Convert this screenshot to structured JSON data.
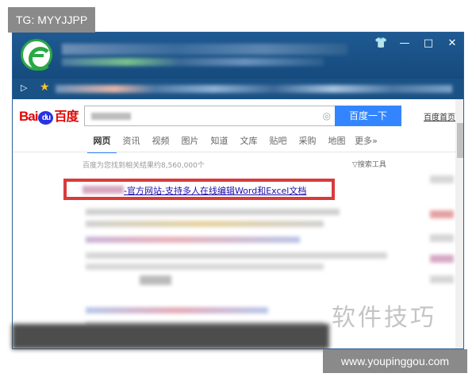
{
  "watermark_tag": "TG: MYYJJPP",
  "window": {
    "titlebar_icons": [
      "shirt-icon",
      "minimize-icon",
      "maximize-icon",
      "close-icon"
    ],
    "titlebar_glyphs": [
      "👕",
      "—",
      "□",
      "✕"
    ]
  },
  "favorites": {
    "play_glyph": "▷",
    "star_glyph": "★"
  },
  "baidu": {
    "logo_bai": "Bai",
    "logo_du": "du",
    "logo_cn": "百度",
    "search_button": "百度一下",
    "camera_glyph": "◎",
    "home_link": "百度首页",
    "tabs": [
      "网页",
      "资讯",
      "视频",
      "图片",
      "知道",
      "文库",
      "贴吧",
      "采购",
      "地图",
      "更多»"
    ],
    "result_count": "百度为您找到相关结果约8,560,000个",
    "search_tools": "▽搜索工具",
    "first_result_title": "-官方网站-支持多人在线编辑Word和Excel文档"
  },
  "watermark_cn": "软件技巧",
  "watermark_url": "www.youpinggou.com",
  "colors": {
    "titlebar": "#1f5a93",
    "search_button": "#3385ff",
    "highlight_box": "#d93b3b",
    "link": "#1a0dab"
  }
}
